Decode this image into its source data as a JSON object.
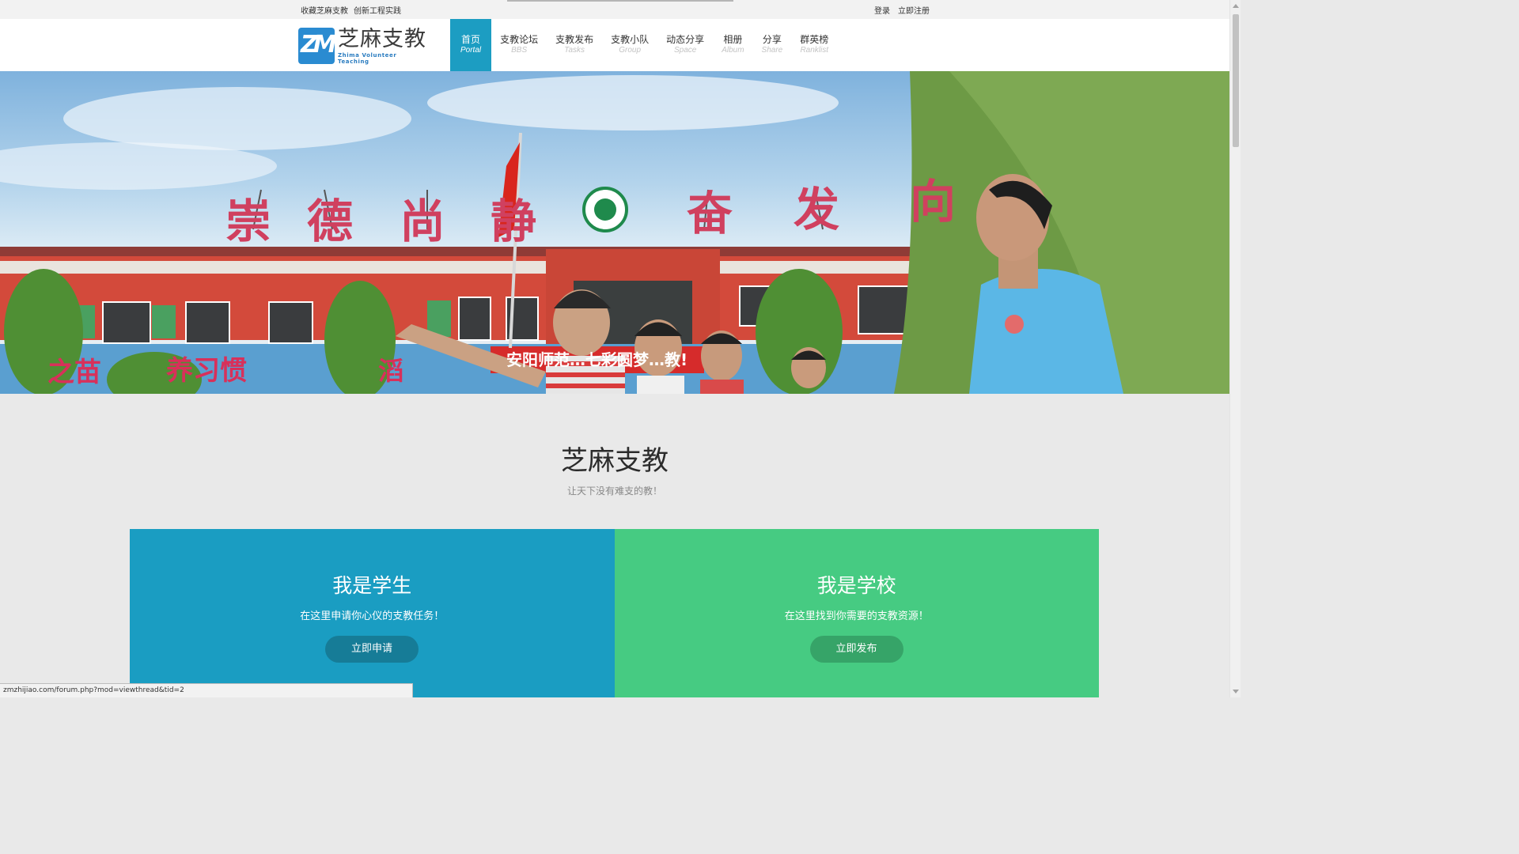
{
  "topbar": {
    "left_links": [
      "收藏芝麻支教",
      "创新工程实践"
    ],
    "login": "登录",
    "register": "立即注册"
  },
  "logo": {
    "mark": "ZM",
    "cn": "芝麻支教",
    "en": "Zhima Volunteer Teaching"
  },
  "nav": [
    {
      "cn": "首页",
      "en": "Portal",
      "active": true
    },
    {
      "cn": "支教论坛",
      "en": "BBS"
    },
    {
      "cn": "支教发布",
      "en": "Tasks"
    },
    {
      "cn": "支教小队",
      "en": "Group"
    },
    {
      "cn": "动态分享",
      "en": "Space"
    },
    {
      "cn": "相册",
      "en": "Album"
    },
    {
      "cn": "分享",
      "en": "Share"
    },
    {
      "cn": "群英榜",
      "en": "Ranklist"
    }
  ],
  "banner": {
    "roof_chars": [
      "崇",
      "德",
      "尚",
      "静",
      "奋",
      "发",
      "向"
    ],
    "banner_left_text": "之苗",
    "banner_left_text2": "养习惯",
    "banner_mid_text": "滔",
    "banner_red_text": "安阳师范…七彩圆梦…教!"
  },
  "intro": {
    "title": "芝麻支教",
    "slogan": "让天下没有难支的教！"
  },
  "cards": {
    "student": {
      "title": "我是学生",
      "desc": "在这里申请你心仪的支教任务！",
      "button": "立即申请"
    },
    "school": {
      "title": "我是学校",
      "desc": "在这里找到你需要的支教资源！",
      "button": "立即发布"
    }
  },
  "status_url": "zmzhijiao.com/forum.php?mod=viewthread&tid=2",
  "colors": {
    "accent": "#1c9dc2",
    "student_card": "#1a9dc2",
    "school_card": "#46cb82"
  }
}
